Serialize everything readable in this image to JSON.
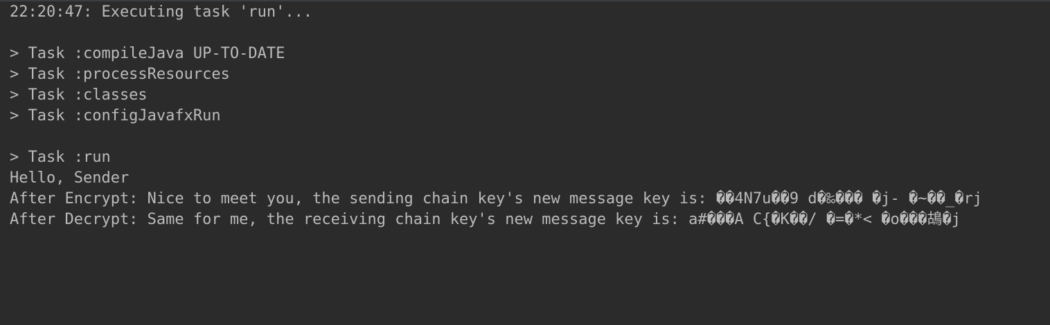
{
  "console": {
    "header": "22:20:47: Executing task 'run'...",
    "lines": [
      "> Task :compileJava UP-TO-DATE",
      "> Task :processResources",
      "> Task :classes",
      "> Task :configJavafxRun",
      "",
      "> Task :run",
      "Hello, Sender",
      "After Encrypt: Nice to meet you, the sending chain key's new message key is: ��4N7u��9 d�‰��� �j- �~��_�rj",
      "After Decrypt: Same for me, the receiving chain key's new message key is: a#���A C{�K��/ �=�*< �o���鴣�j"
    ]
  },
  "colors": {
    "background": "#2b2b2b",
    "text": "#bbbbbb"
  }
}
